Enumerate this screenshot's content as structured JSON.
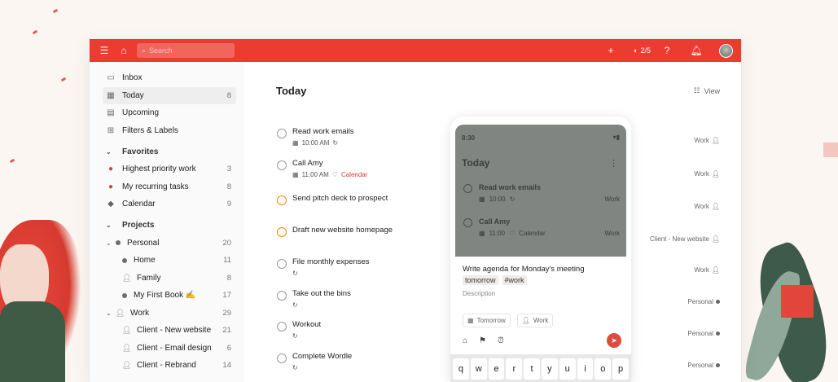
{
  "topbar": {
    "search_placeholder": "Search",
    "karma": "2/5"
  },
  "sidebar": {
    "top_items": [
      {
        "label": "Inbox",
        "count": ""
      },
      {
        "label": "Today",
        "count": "8"
      },
      {
        "label": "Upcoming",
        "count": ""
      },
      {
        "label": "Filters & Labels",
        "count": ""
      }
    ],
    "favorites_title": "Favorites",
    "favorites": [
      {
        "label": "Highest priority work",
        "count": "3"
      },
      {
        "label": "My recurring tasks",
        "count": "8"
      },
      {
        "label": "Calendar",
        "count": "9"
      }
    ],
    "projects_title": "Projects",
    "personal": {
      "label": "Personal",
      "count": "20"
    },
    "personal_children": [
      {
        "label": "Home",
        "count": "11"
      },
      {
        "label": "Family",
        "count": "8"
      },
      {
        "label": "My First Book ✍️",
        "count": "17"
      }
    ],
    "work": {
      "label": "Work",
      "count": "29"
    },
    "work_children": [
      {
        "label": "Client - New website",
        "count": "21"
      },
      {
        "label": "Client - Email design",
        "count": "6"
      },
      {
        "label": "Client - Rebrand",
        "count": "14"
      }
    ]
  },
  "main": {
    "title": "Today",
    "view_label": "View",
    "tasks": [
      {
        "title": "Read work emails",
        "time": "10:00 AM",
        "calendar": "",
        "project": "Work"
      },
      {
        "title": "Call Amy",
        "time": "11:00 AM",
        "calendar": "Calendar",
        "project": "Work"
      },
      {
        "title": "Send pitch deck to prospect",
        "time": "",
        "calendar": "",
        "project": "Work"
      },
      {
        "title": "Draft new website homepage",
        "time": "",
        "calendar": "",
        "project": "Client - New website"
      },
      {
        "title": "File monthly expenses",
        "time": "",
        "calendar": "",
        "project": "Work"
      },
      {
        "title": "Take out the bins",
        "time": "",
        "calendar": "",
        "project": "Personal"
      },
      {
        "title": "Workout",
        "time": "",
        "calendar": "",
        "project": "Personal"
      },
      {
        "title": "Complete Wordle",
        "time": "",
        "calendar": "",
        "project": "Personal"
      }
    ]
  },
  "phone": {
    "time": "8:30",
    "title": "Today",
    "tasks": [
      {
        "title": "Read work emails",
        "time": "10:00",
        "calendar": "",
        "project": "Work"
      },
      {
        "title": "Call Amy",
        "time": "11:00",
        "calendar": "Calendar",
        "project": "Work"
      }
    ],
    "quick_add": {
      "text": "Write agenda for Monday's meeting",
      "chips": [
        "tomorrow",
        "#work"
      ],
      "description_placeholder": "Description",
      "date_option": "Tomorrow",
      "project_option": "Work"
    },
    "keyboard": [
      "q",
      "w",
      "e",
      "r",
      "t",
      "y",
      "u",
      "i",
      "o",
      "p"
    ]
  },
  "colors": {
    "brand": "#ec3b30",
    "priority": "#eb8909"
  }
}
